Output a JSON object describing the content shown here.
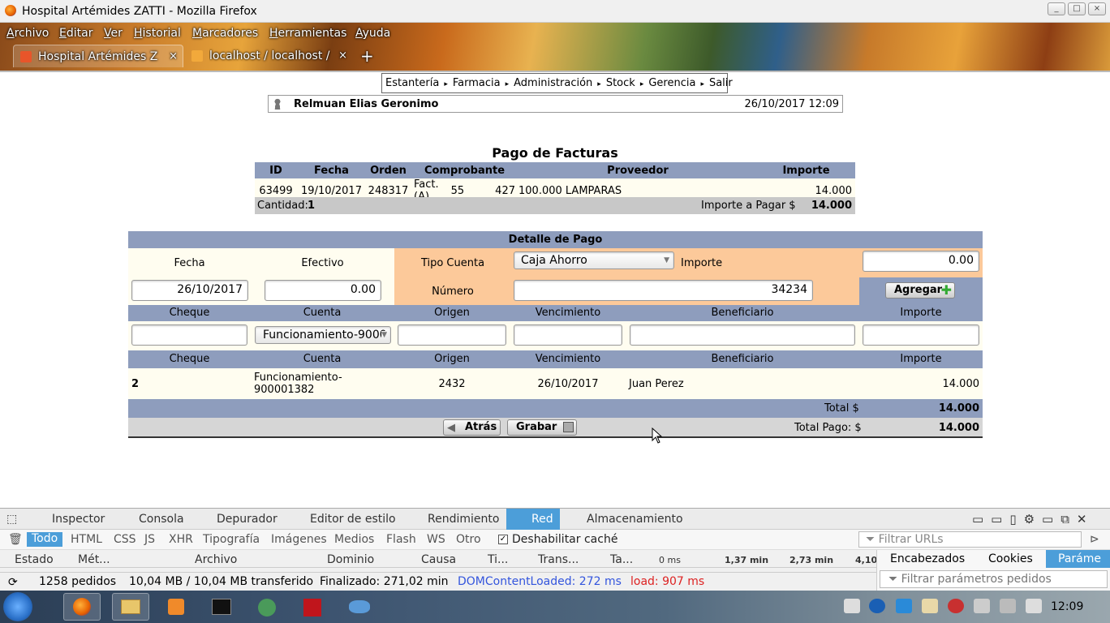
{
  "window": {
    "title": "Hospital Artémides ZATTI - Mozilla Firefox",
    "min": "_",
    "max": "□",
    "close": "×"
  },
  "menubar": [
    "Archivo",
    "Editar",
    "Ver",
    "Historial",
    "Marcadores",
    "Herramientas",
    "Ayuda"
  ],
  "tabs": [
    {
      "label": "Hospital Artémides Z",
      "close": "×"
    },
    {
      "label": "localhost / localhost /",
      "close": "×"
    }
  ],
  "newtab": "+",
  "nav": {
    "items": [
      "Estantería",
      "Farmacia",
      "Administración",
      "Stock",
      "Gerencia",
      "Salir"
    ],
    "arrow": "▸"
  },
  "user": {
    "name": "Relmuan Elias Geronimo",
    "datetime": "26/10/2017 12:09"
  },
  "page_title": "Pago de Facturas",
  "facturas": {
    "headers": [
      "ID",
      "Fecha",
      "Orden",
      "Comprobante",
      "Proveedor",
      "Importe"
    ],
    "rows": [
      {
        "id": "63499",
        "fecha": "19/10/2017",
        "orden": "248317",
        "tipo": "Fact.(A)",
        "pv": "55",
        "num": "427",
        "proveedor": "100.000 LAMPARAS",
        "importe": "14.000"
      }
    ],
    "cantidad_label": "Cantidad:",
    "cantidad": "1",
    "importe_label": "Importe a Pagar $",
    "importe_total": "14.000"
  },
  "detalle": {
    "title": "Detalle de Pago",
    "fecha_label": "Fecha",
    "fecha_value": "26/10/2017",
    "efectivo_label": "Efectivo",
    "efectivo_value": "0.00",
    "tipo_cuenta_label": "Tipo Cuenta",
    "tipo_cuenta_value": "Caja Ahorro",
    "importe_label": "Importe",
    "importe_value": "0.00",
    "numero_label": "Número",
    "numero_value": "34234",
    "agregar_label": "Agregar",
    "cheque_headers": [
      "Cheque",
      "Cuenta",
      "Origen",
      "Vencimiento",
      "Beneficiario",
      "Importe"
    ],
    "cuenta_select": "Funcionamiento-9000",
    "list_headers": [
      "Cheque",
      "Cuenta",
      "Origen",
      "Vencimiento",
      "Beneficiario",
      "Importe"
    ],
    "rows": [
      {
        "cheque": "2",
        "cuenta": "Funcionamiento-900001382",
        "cuenta_l1": "Funcionamiento-",
        "cuenta_l2": "900001382",
        "origen": "2432",
        "vencimiento": "26/10/2017",
        "beneficiario": "Juan Perez",
        "importe": "14.000"
      }
    ],
    "total_label": "Total $",
    "total_value": "14.000",
    "atras_label": "Atrás",
    "grabar_label": "Grabar",
    "total_pago_label": "Total Pago: $",
    "total_pago_value": "14.000"
  },
  "devtools": {
    "tools": [
      "Inspector",
      "Consola",
      "Depurador",
      "Editor de estilo",
      "Rendimiento",
      "Red",
      "Almacenamiento"
    ],
    "active_tool": "Red",
    "filters": [
      "Todo",
      "HTML",
      "CSS",
      "JS",
      "XHR",
      "Tipografía",
      "Imágenes",
      "Medios",
      "Flash",
      "WS",
      "Otro"
    ],
    "disable_cache": "Deshabilitar caché",
    "filter_placeholder": "Filtrar URLs",
    "columns": [
      "Estado",
      "Mét...",
      "Archivo",
      "Dominio",
      "Causa",
      "Ti...",
      "Trans...",
      "Ta...",
      "0 ms",
      "1,37 min",
      "2,73 min",
      "4,10"
    ],
    "side_tabs": [
      "Encabezados",
      "Cookies",
      "Paráme"
    ],
    "side_filter": "Filtrar parámetros pedidos",
    "status": {
      "requests": "1258 pedidos",
      "size": "10,04 MB / 10,04 MB transferido",
      "finished": "Finalizado: 271,02 min",
      "dcl": "DOMContentLoaded: 272 ms",
      "load": "load: 907 ms"
    }
  },
  "taskbar": {
    "clock": "12:09"
  }
}
